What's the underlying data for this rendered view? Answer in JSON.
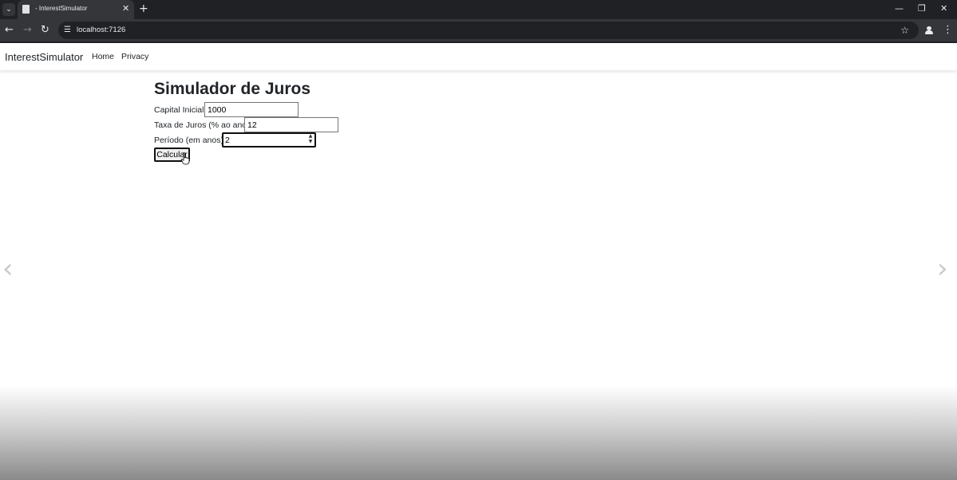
{
  "browser": {
    "tab_title": "- InterestSimulator",
    "tab_close_glyph": "✕",
    "new_tab_glyph": "+",
    "tab_menu_glyph": "⌄",
    "url": "localhost:7126",
    "window_controls": {
      "minimize": "—",
      "restore": "❐",
      "close": "✕"
    },
    "nav": {
      "back": "←",
      "forward": "→",
      "reload": "↻"
    },
    "site_info_glyph": "☰",
    "bookmark_glyph": "☆",
    "menu_glyph": "⋮"
  },
  "site_nav": {
    "brand": "InterestSimulator",
    "links": [
      "Home",
      "Privacy"
    ]
  },
  "form": {
    "title": "Simulador de Juros",
    "capital_label": "Capital Inicial:",
    "capital_value": "1000",
    "rate_label": "Taxa de Juros (% ao ano):",
    "rate_value": "12",
    "period_label": "Período (em anos):",
    "period_value": "2",
    "submit_label": "Calcular"
  },
  "carousel": {
    "prev_glyph": "‹",
    "next_glyph": "›"
  },
  "icons": {
    "favicon": "page-icon",
    "cursor": "hand-pointer-icon",
    "profile": "person-icon"
  },
  "colors": {
    "chrome_dark": "#202124",
    "chrome_toolbar": "#35363a",
    "text": "#212529"
  }
}
